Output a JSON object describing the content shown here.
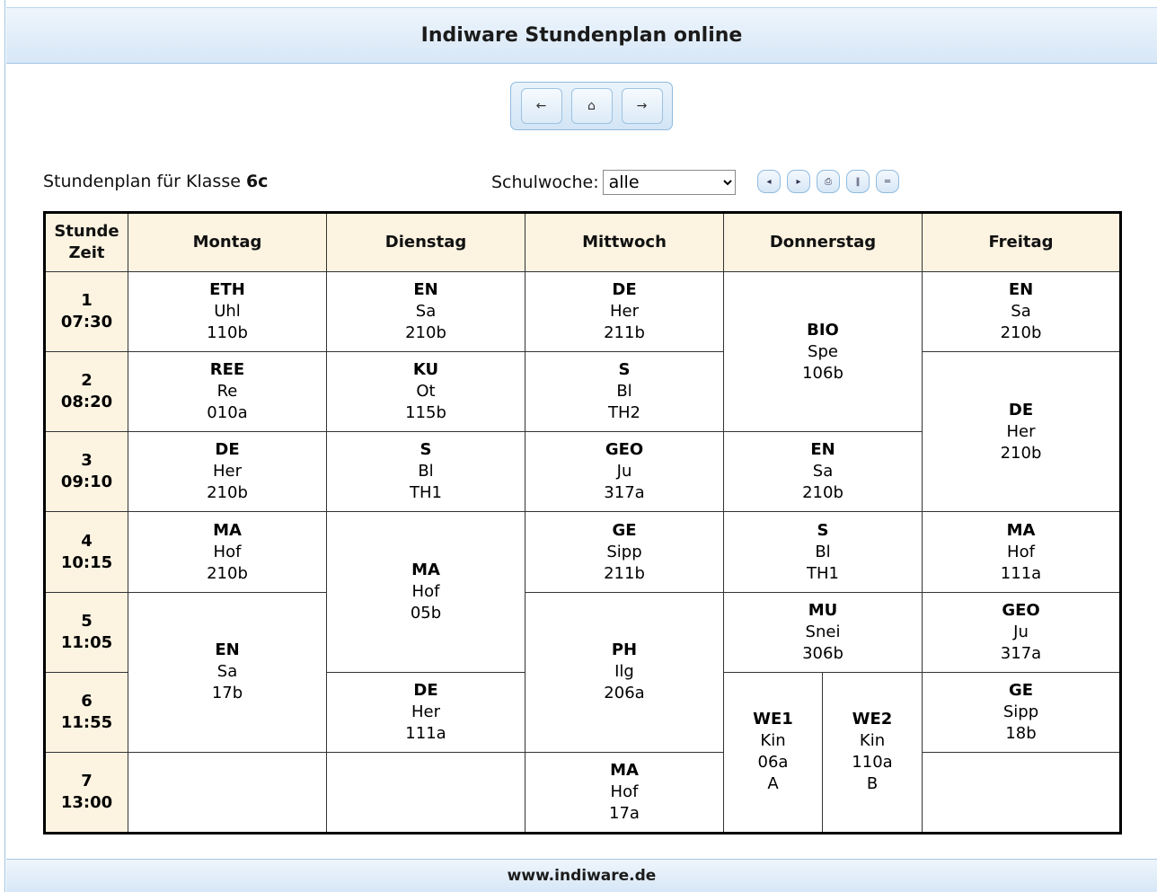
{
  "header": {
    "title": "Indiware Stundenplan online"
  },
  "nav": {
    "back": "←",
    "home": "⌂",
    "forward": "→"
  },
  "class_label": {
    "prefix": "Stundenplan für Klasse",
    "klasse": "6c"
  },
  "woche": {
    "label": "Schulwoche:",
    "selected": "alle"
  },
  "tools": {
    "prev": "◂",
    "next": "▸",
    "print": "⎙",
    "vertical": "‖",
    "horizontal": "═"
  },
  "table": {
    "corner": {
      "line1": "Stunde",
      "line2": "Zeit"
    },
    "days": [
      "Montag",
      "Dienstag",
      "Mittwoch",
      "Donnerstag",
      "Freitag"
    ],
    "periods": [
      {
        "num": "1",
        "time": "07:30"
      },
      {
        "num": "2",
        "time": "08:20"
      },
      {
        "num": "3",
        "time": "09:10"
      },
      {
        "num": "4",
        "time": "10:15"
      },
      {
        "num": "5",
        "time": "11:05"
      },
      {
        "num": "6",
        "time": "11:55"
      },
      {
        "num": "7",
        "time": "13:00"
      }
    ],
    "lessons": {
      "mo1": {
        "subject": "ETH",
        "teacher": "Uhl",
        "room": "110b"
      },
      "di1": {
        "subject": "EN",
        "teacher": "Sa",
        "room": "210b"
      },
      "mi1": {
        "subject": "DE",
        "teacher": "Her",
        "room": "211b"
      },
      "do12": {
        "subject": "BIO",
        "teacher": "Spe",
        "room": "106b"
      },
      "fr1": {
        "subject": "EN",
        "teacher": "Sa",
        "room": "210b"
      },
      "mo2": {
        "subject": "REE",
        "teacher": "Re",
        "room": "010a"
      },
      "di2": {
        "subject": "KU",
        "teacher": "Ot",
        "room": "115b"
      },
      "mi2": {
        "subject": "S",
        "teacher": "Bl",
        "room": "TH2"
      },
      "fr23": {
        "subject": "DE",
        "teacher": "Her",
        "room": "210b"
      },
      "mo3": {
        "subject": "DE",
        "teacher": "Her",
        "room": "210b"
      },
      "di3": {
        "subject": "S",
        "teacher": "Bl",
        "room": "TH1"
      },
      "mi3": {
        "subject": "GEO",
        "teacher": "Ju",
        "room": "317a"
      },
      "do3": {
        "subject": "EN",
        "teacher": "Sa",
        "room": "210b"
      },
      "mo4": {
        "subject": "MA",
        "teacher": "Hof",
        "room": "210b"
      },
      "di45": {
        "subject": "MA",
        "teacher": "Hof",
        "room": "05b"
      },
      "mi4": {
        "subject": "GE",
        "teacher": "Sipp",
        "room": "211b"
      },
      "do4": {
        "subject": "S",
        "teacher": "Bl",
        "room": "TH1"
      },
      "fr4": {
        "subject": "MA",
        "teacher": "Hof",
        "room": "111a"
      },
      "mo56": {
        "subject": "EN",
        "teacher": "Sa",
        "room": "17b"
      },
      "mi56": {
        "subject": "PH",
        "teacher": "Ilg",
        "room": "206a"
      },
      "do5": {
        "subject": "MU",
        "teacher": "Snei",
        "room": "306b"
      },
      "fr5": {
        "subject": "GEO",
        "teacher": "Ju",
        "room": "317a"
      },
      "di6": {
        "subject": "DE",
        "teacher": "Her",
        "room": "111a"
      },
      "do67a": {
        "subject": "WE1",
        "teacher": "Kin",
        "room": "06a",
        "group": "A"
      },
      "do67b": {
        "subject": "WE2",
        "teacher": "Kin",
        "room": "110a",
        "group": "B"
      },
      "fr6": {
        "subject": "GE",
        "teacher": "Sipp",
        "room": "18b"
      },
      "mi7": {
        "subject": "MA",
        "teacher": "Hof",
        "room": "17a"
      }
    }
  },
  "footer": {
    "url": "www.indiware.de"
  }
}
